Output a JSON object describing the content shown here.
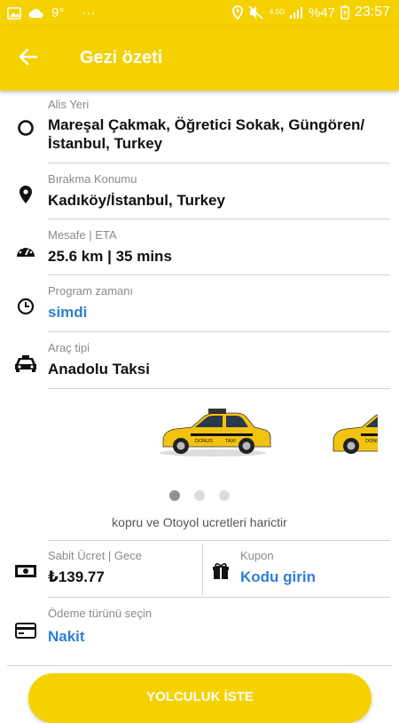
{
  "status_bar": {
    "temperature": "9°",
    "dots": "···",
    "network": "4,5G",
    "battery": "%47",
    "time": "23:57"
  },
  "header": {
    "title": "Gezi özeti",
    "back_icon": "arrow-left-icon"
  },
  "pickup": {
    "label": "Alis Yeri",
    "value": "Mareşal Çakmak, Öğretici Sokak, Güngören/ İstanbul, Turkey",
    "icon": "circle-outline-icon"
  },
  "dropoff": {
    "label": "Bırakma Konumu",
    "value": "Kadıköy/İstanbul, Turkey",
    "icon": "location-pin-icon"
  },
  "distance": {
    "label": "Mesafe | ETA",
    "value": "25.6 km | 35 mins",
    "icon": "speedometer-icon"
  },
  "schedule": {
    "label": "Program zamanı",
    "value": "simdi",
    "icon": "clock-icon"
  },
  "vehicle": {
    "label": "Araç tipi",
    "value": "Anadolu Taksi",
    "icon": "taxi-icon"
  },
  "carousel": {
    "car_text": "DONUS",
    "taxi_text": "TAXI",
    "dots": 3,
    "active_index": 0
  },
  "note": "kopru ve Otoyol ucretleri harictir",
  "fare": {
    "label": "Sabit Ücret | Gece",
    "value": "₺139.77",
    "icon": "money-icon"
  },
  "coupon": {
    "label": "Kupon",
    "value": "Kodu girin",
    "icon": "gift-icon"
  },
  "payment": {
    "label": "Ödeme türünü seçin",
    "value": "Nakit",
    "icon": "credit-card-icon"
  },
  "request_button": "YOLCULUK İSTE",
  "colors": {
    "accent": "#f5d100",
    "link": "#2f7fd6"
  }
}
